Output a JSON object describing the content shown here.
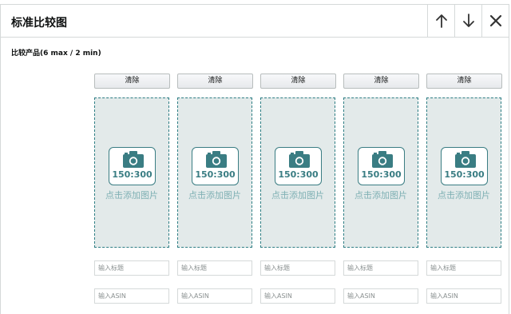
{
  "dialog": {
    "title": "标准比较图",
    "subtitle": "比较产品(6 max / 2 min)"
  },
  "header_buttons": [
    {
      "name": "move-up-button",
      "icon": "arrow-up-icon"
    },
    {
      "name": "move-down-button",
      "icon": "arrow-down-icon"
    },
    {
      "name": "close-button",
      "icon": "close-icon"
    }
  ],
  "products": [
    {
      "clear_label": "清除",
      "image_size": "150:300",
      "image_hint": "点击添加图片",
      "title_placeholder": "输入标题",
      "asin_placeholder": "输入ASIN"
    },
    {
      "clear_label": "清除",
      "image_size": "150:300",
      "image_hint": "点击添加图片",
      "title_placeholder": "输入标题",
      "asin_placeholder": "输入ASIN"
    },
    {
      "clear_label": "清除",
      "image_size": "150:300",
      "image_hint": "点击添加图片",
      "title_placeholder": "输入标题",
      "asin_placeholder": "输入ASIN"
    },
    {
      "clear_label": "清除",
      "image_size": "150:300",
      "image_hint": "点击添加图片",
      "title_placeholder": "输入标题",
      "asin_placeholder": "输入ASIN"
    },
    {
      "clear_label": "清除",
      "image_size": "150:300",
      "image_hint": "点击添加图片",
      "title_placeholder": "输入标题",
      "asin_placeholder": "输入ASIN"
    }
  ],
  "colors": {
    "accent": "#3a7d83",
    "dropzone_bg": "#e3eaea",
    "border": "#d5d9d9"
  }
}
